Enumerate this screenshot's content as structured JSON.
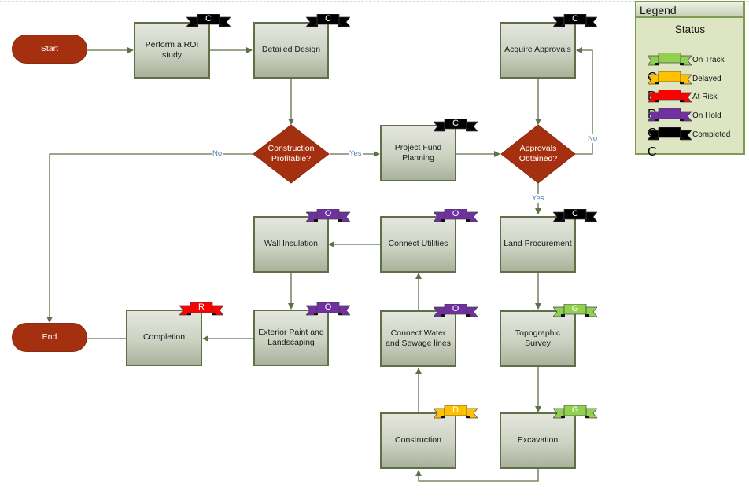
{
  "status_colors": {
    "G": {
      "fill": "#92d050",
      "dark": "#6a9a3a",
      "label": "On Track"
    },
    "D": {
      "fill": "#ffc000",
      "dark": "#c79400",
      "label": "Delayed"
    },
    "R": {
      "fill": "#ff0000",
      "dark": "#b30000",
      "label": "At Risk"
    },
    "O": {
      "fill": "#7030a0",
      "dark": "#4d1f70",
      "label": "On Hold"
    },
    "C": {
      "fill": "#000000",
      "dark": "#222222",
      "label": "Completed"
    }
  },
  "legend": {
    "title": "Legend",
    "subtitle": "Status",
    "items": [
      {
        "code": "G",
        "label": "On Track"
      },
      {
        "code": "D",
        "label": "Delayed"
      },
      {
        "code": "R",
        "label": "At Risk"
      },
      {
        "code": "O",
        "label": "On Hold"
      },
      {
        "code": "C",
        "label": "Completed"
      }
    ]
  },
  "nodes": {
    "start": {
      "label": "Start"
    },
    "end": {
      "label": "End"
    },
    "roi_study": {
      "label": "Perform a ROI study",
      "status": "C"
    },
    "detailed_design": {
      "label": "Detailed Design",
      "status": "C"
    },
    "acquire_approvals": {
      "label": "Acquire Approvals",
      "status": "C"
    },
    "construction_profitable": {
      "label": "Construction Profitable?"
    },
    "project_fund_planning": {
      "label": "Project Fund Planning",
      "status": "C"
    },
    "approvals_obtained": {
      "label": "Approvals Obtained?"
    },
    "wall_insulation": {
      "label": "Wall Insulation",
      "status": "O"
    },
    "connect_utilities": {
      "label": "Connect Utilities",
      "status": "O"
    },
    "land_procurement": {
      "label": "Land Procurement",
      "status": "C"
    },
    "completion": {
      "label": "Completion",
      "status": "R"
    },
    "exterior_paint": {
      "label": "Exterior Paint and Landscaping",
      "status": "O"
    },
    "connect_water": {
      "label": "Connect Water and Sewage lines",
      "status": "O"
    },
    "topographic_survey": {
      "label": "Topographic Survey",
      "status": "G"
    },
    "construction": {
      "label": "Construction",
      "status": "D"
    },
    "excavation": {
      "label": "Excavation",
      "status": "G"
    }
  },
  "edge_labels": {
    "profitable_no": "No",
    "profitable_yes": "Yes",
    "approvals_no": "No",
    "approvals_yes": "Yes"
  }
}
